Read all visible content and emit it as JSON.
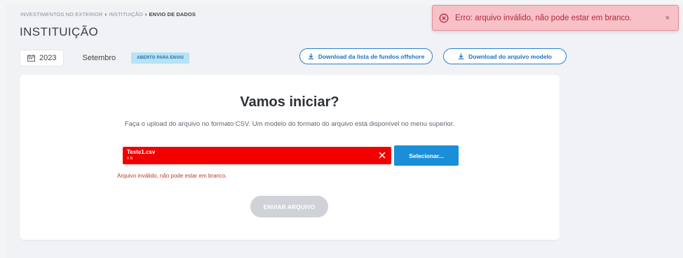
{
  "breadcrumb": {
    "items": [
      "INVESTIMENTOS NO EXTERIOR",
      "INSTITUIÇÃO"
    ],
    "current": "ENVIO DE DADOS",
    "separator": "›"
  },
  "page_title": "INSTITUIÇÃO",
  "filters": {
    "year": "2023",
    "month": "Setembro",
    "status": "ABERTO PARA ENVIO"
  },
  "downloads": {
    "offshore_label": "Download da lista de fundos offshore",
    "model_label": "Download do arquivo modelo"
  },
  "card": {
    "title": "Vamos iniciar?",
    "description": "Faça o upload do arquivo no formato CSV. Um modelo do formato do arquivo está disponível no menu superior.",
    "file": {
      "name": "Teste1.csv",
      "size": "0 B"
    },
    "select_label": "Selecionar...",
    "error_message": "Arquivo inválido, não pode estar em branco.",
    "submit_label": "ENVIAR ARQUIVO"
  },
  "toast": {
    "message": "Erro: arquivo inválido, não pode estar em branco.",
    "close": "×"
  },
  "colors": {
    "accent": "#1a8fd8",
    "error": "#f20000",
    "toast_bg": "#f7c1c7",
    "badge_bg": "#b8e2f5"
  },
  "icons": {
    "year": "calendar-icon",
    "download": "download-icon",
    "remove_file": "close-icon",
    "toast": "error-circle-icon"
  }
}
